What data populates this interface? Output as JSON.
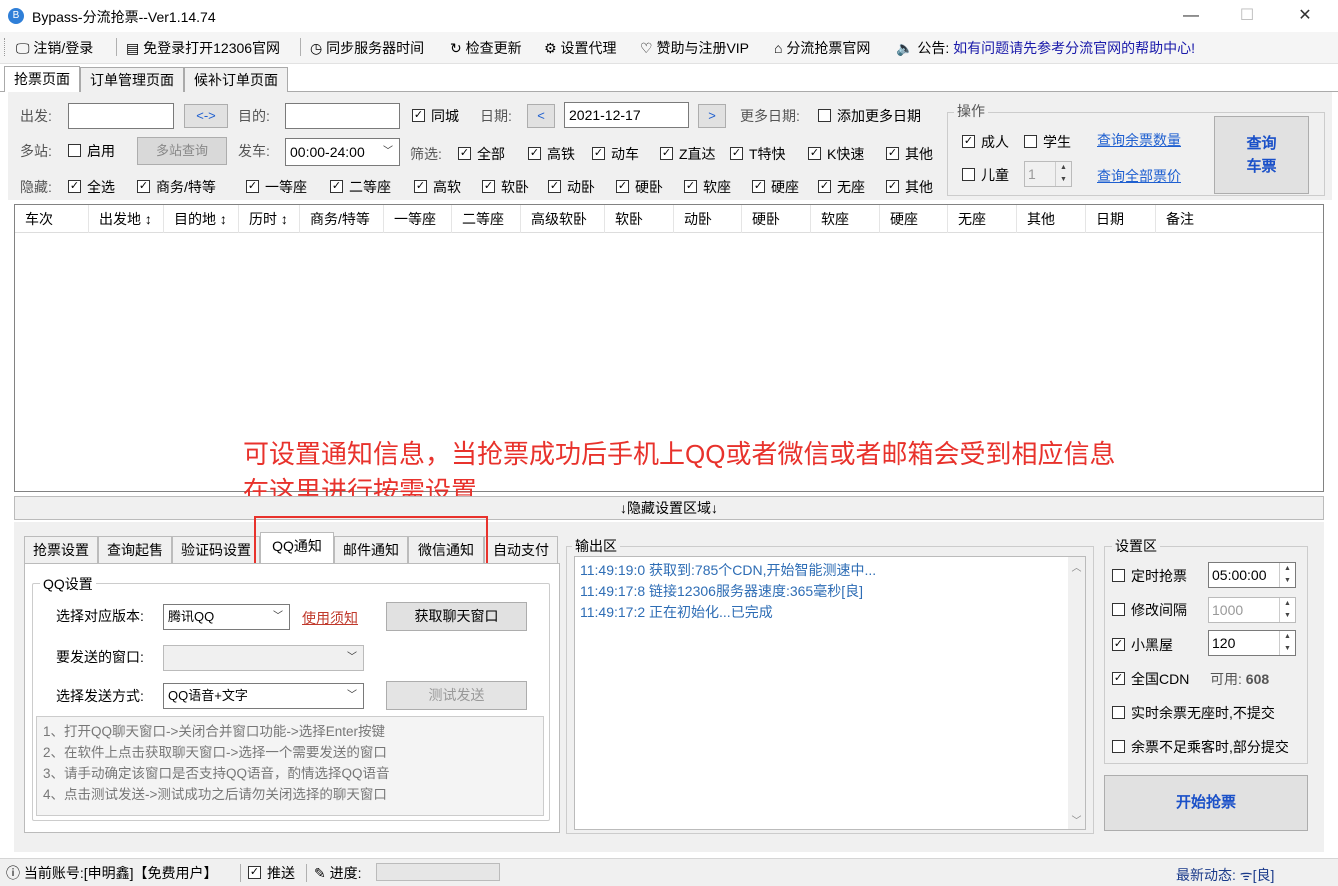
{
  "window": {
    "title": "Bypass-分流抢票--Ver1.14.74",
    "minimize": "—",
    "maximize": "☐",
    "close": "✕"
  },
  "menu": {
    "login": "注销/登录",
    "open_12306": "免登录打开12306官网",
    "sync_time": "同步服务器时间",
    "check_update": "检查更新",
    "proxy": "设置代理",
    "sponsor": "赞助与注册VIP",
    "official": "分流抢票官网",
    "notice_label": "公告:",
    "notice_text": "如有问题请先参考分流官网的帮助中心!"
  },
  "page_tabs": [
    "抢票页面",
    "订单管理页面",
    "候补订单页面"
  ],
  "search": {
    "from_label": "出发:",
    "from_value": "",
    "swap": "<->",
    "to_label": "目的:",
    "to_value": "",
    "same_city": "同城",
    "date_label": "日期:",
    "date_value": "2021-12-17",
    "prev": "<",
    "next": ">",
    "more_dates_label": "更多日期:",
    "add_more_dates": "添加更多日期",
    "multi_label": "多站:",
    "enable": "启用",
    "multi_query": "多站查询",
    "depart_label": "发车:",
    "depart_value": "00:00-24:00",
    "filter_label": "筛选:",
    "filters": [
      "全部",
      "高铁",
      "动车",
      "Z直达",
      "T特快",
      "K快速",
      "其他"
    ],
    "hide_label": "隐藏:",
    "hide_opts": [
      "全选",
      "商务/特等",
      "一等座",
      "二等座",
      "高软",
      "软卧",
      "动卧",
      "硬卧",
      "软座",
      "硬座",
      "无座",
      "其他"
    ]
  },
  "operate": {
    "title": "操作",
    "adult": "成人",
    "student": "学生",
    "child": "儿童",
    "child_count": "1",
    "query_remaining": "查询余票数量",
    "query_price": "查询全部票价",
    "query_btn_line1": "查询",
    "query_btn_line2": "车票"
  },
  "grid_columns": [
    "车次",
    "出发地 ↕",
    "目的地 ↕",
    "历时 ↕",
    "商务/特等",
    "一等座",
    "二等座",
    "高级软卧",
    "软卧",
    "动卧",
    "硬卧",
    "软座",
    "硬座",
    "无座",
    "其他",
    "日期",
    "备注"
  ],
  "annotation": {
    "line1": "可设置通知信息，当抢票成功后手机上QQ或者微信或者邮箱会受到相应信息",
    "line2": "在这里进行按需设置"
  },
  "hide_settings": "↓隐藏设置区域↓",
  "sub_tabs": [
    "抢票设置",
    "查询起售",
    "验证码设置",
    "QQ通知",
    "邮件通知",
    "微信通知",
    "自动支付"
  ],
  "qq": {
    "group_title": "QQ设置",
    "version_label": "选择对应版本:",
    "version_value": "腾讯QQ",
    "usage_notice": "使用须知",
    "get_window_btn": "获取聊天窗口",
    "target_label": "要发送的窗口:",
    "target_value": "",
    "method_label": "选择发送方式:",
    "method_value": "QQ语音+文字",
    "test_btn": "测试发送",
    "instructions": [
      "1、打开QQ聊天窗口->关闭合并窗口功能->选择Enter按键",
      "2、在软件上点击获取聊天窗口->选择一个需要发送的窗口",
      "3、请手动确定该窗口是否支持QQ语音，酌情选择QQ语音",
      "4、点击测试发送->测试成功之后请勿关闭选择的聊天窗口"
    ]
  },
  "output": {
    "title": "输出区",
    "lines": [
      "11:49:19:0  获取到:785个CDN,开始智能测速中...",
      "11:49:17:8  链接12306服务器速度:365毫秒[良]",
      "11:49:17:2  正在初始化...已完成"
    ]
  },
  "settings": {
    "title": "设置区",
    "timed": "定时抢票",
    "timed_value": "05:00:00",
    "interval": "修改间隔",
    "interval_value": "1000",
    "blackroom": "小黑屋",
    "blackroom_value": "120",
    "cdn": "全国CDN",
    "cdn_available_label": "可用:",
    "cdn_available": "608",
    "realtime_noseat": "实时余票无座时,不提交",
    "partial_submit": "余票不足乘客时,部分提交",
    "start_btn": "开始抢票"
  },
  "status": {
    "account": "当前账号:[申明鑫]【免费用户】",
    "push": "推送",
    "progress_label": "进度:",
    "latest_label": "最新动态:",
    "latest_value": "[良]"
  },
  "colors": {
    "annotation": "#e8322c",
    "link": "#1e5fd0",
    "log": "#2e6db5",
    "start": "#1a50c8"
  }
}
